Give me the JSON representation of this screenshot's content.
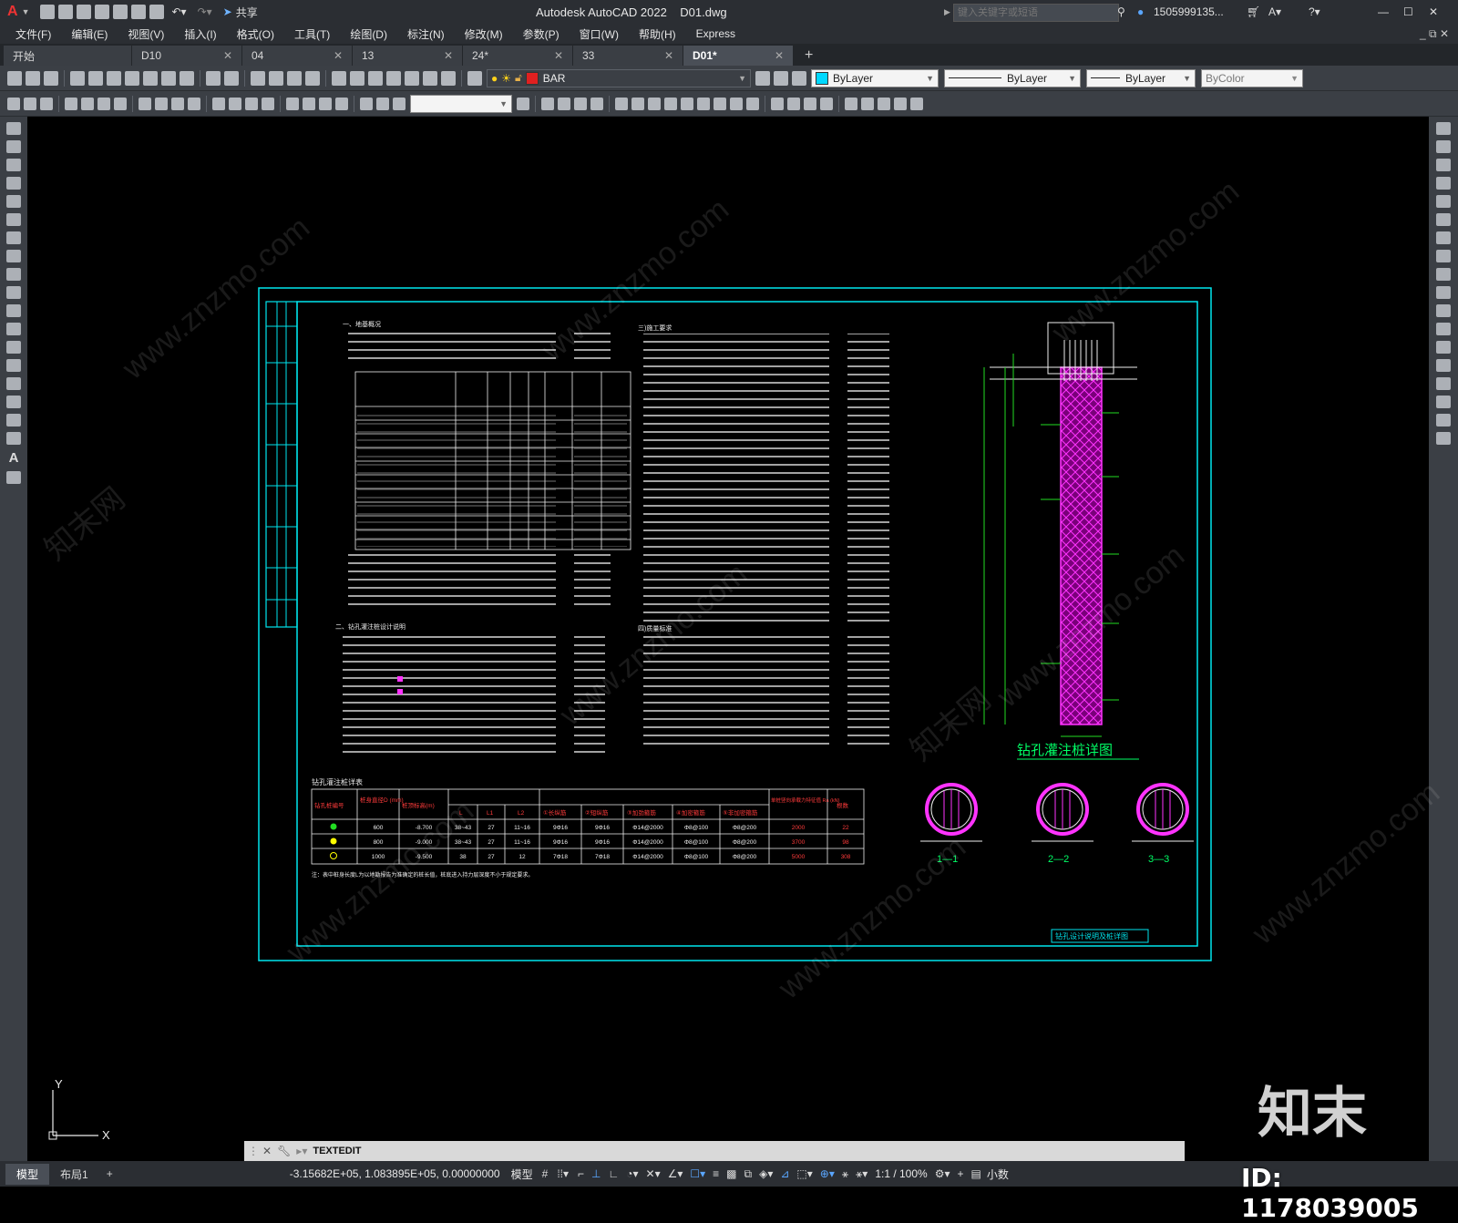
{
  "title": {
    "app": "Autodesk AutoCAD 2022",
    "file": "D01.dwg",
    "share": "共享",
    "search_placeholder": "键入关键字或短语",
    "user": "1505999135..."
  },
  "menu": [
    "文件(F)",
    "编辑(E)",
    "视图(V)",
    "插入(I)",
    "格式(O)",
    "工具(T)",
    "绘图(D)",
    "标注(N)",
    "修改(M)",
    "参数(P)",
    "窗口(W)",
    "帮助(H)",
    "Express"
  ],
  "tabs": [
    {
      "label": "开始"
    },
    {
      "label": "D10"
    },
    {
      "label": "04"
    },
    {
      "label": "13"
    },
    {
      "label": "24*"
    },
    {
      "label": "33"
    },
    {
      "label": "D01*"
    }
  ],
  "layer": {
    "name": "BAR",
    "color": "#e02020"
  },
  "properties": {
    "color": "ByLayer",
    "color_swatch": "#00d8ff",
    "linetype": "ByLayer",
    "lineweight": "ByLayer",
    "plotstyle": "ByColor"
  },
  "drawing": {
    "section_titles": [
      "一、地基概况",
      "二、钻孔灌注桩设计说明",
      "三)施工要求",
      "四)质量标准"
    ],
    "pile_title": "钻孔灌注桩详图",
    "pile_table_title": "钻孔灌注桩详表",
    "pile_table_headers": [
      "钻孔桩编号",
      "桩身直径D (mm)",
      "桩顶标高(m)",
      "L",
      "L1",
      "L2",
      "①长纵筋",
      "②短纵筋",
      "③加劲箍筋",
      "④加密箍筋",
      "⑤非加密箍筋",
      "单桩竖向承载力特征值 Ra (kN)",
      "根数"
    ],
    "pile_rows": [
      [
        "600",
        "-8.700",
        "38~43",
        "27",
        "11~16",
        "9Φ16",
        "9Φ16",
        "Φ14@2000",
        "Φ8@100",
        "Φ8@200",
        "2000",
        "22"
      ],
      [
        "800",
        "-9.000",
        "38~43",
        "27",
        "11~16",
        "9Φ16",
        "9Φ16",
        "Φ14@2000",
        "Φ8@100",
        "Φ8@200",
        "3700",
        "98"
      ],
      [
        "1000",
        "-9.500",
        "38",
        "27",
        "12",
        "7Φ18",
        "7Φ18",
        "Φ14@2000",
        "Φ8@100",
        "Φ8@200",
        "5000",
        "308"
      ]
    ],
    "table_note": "注：表中桩身长度L为以地勘报告为准确定的桩长值，桩底进入持力层深度不小于规定要求。",
    "sections": [
      "1—1",
      "2—2",
      "3—3"
    ],
    "stamp": "钻孔设计说明及桩详图"
  },
  "ucs": {
    "x": "X",
    "y": "Y"
  },
  "command": {
    "text": "TEXTEDIT"
  },
  "layout_tabs": [
    "模型",
    "布局1"
  ],
  "status": {
    "coords": "-3.15682E+05, 1.083895E+05, 0.00000000",
    "mode": "模型",
    "scale": "1:1 / 100%",
    "units": "小数"
  },
  "watermark": {
    "brand": "知末",
    "id": "ID: 1178039005",
    "site": "www.znzmo.com",
    "site_cn": "知末网"
  }
}
